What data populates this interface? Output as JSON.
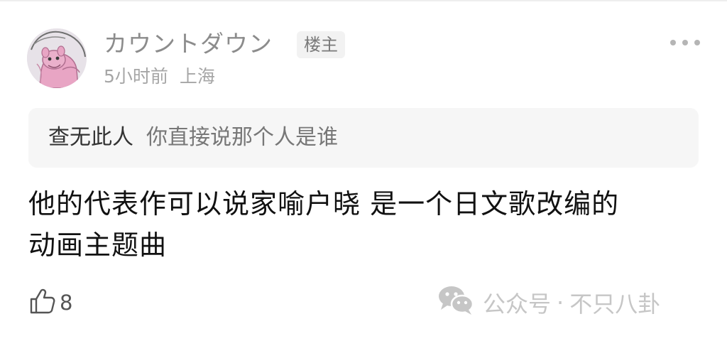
{
  "comment": {
    "username": "カウントダウン",
    "badge": "楼主",
    "time": "5小时前",
    "location": "上海",
    "quote": {
      "author": "查无此人",
      "text": "你直接说那个人是谁"
    },
    "body_lines": [
      "他的代表作可以说家喻户晓 是一个日文歌改编的",
      "动画主题曲"
    ],
    "likes": "8",
    "icons": {
      "more": "more-dots-icon",
      "like": "thumbs-up-icon",
      "watermark": "wechat-icon"
    }
  },
  "watermark": {
    "label": "公众号",
    "separator": "·",
    "name": "不只八卦"
  },
  "colors": {
    "username": "#8c8c8c",
    "quote_bg": "#f6f6f6",
    "watermark": "#c6c6c6",
    "avatar_pink": "#e8a5c4"
  }
}
